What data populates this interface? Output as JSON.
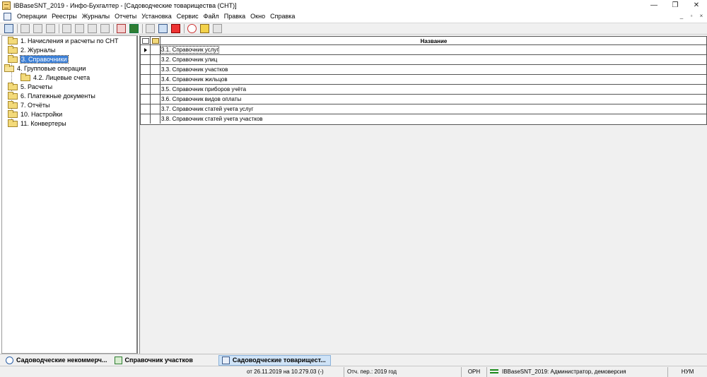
{
  "window": {
    "title": "IBBaseSNT_2019 - Инфо-Бухгалтер - [Садоводческие товарищества (СНТ)]",
    "controls": [
      "—",
      "❐",
      "✕"
    ]
  },
  "menu": {
    "items": [
      "Операции",
      "Реестры",
      "Журналы",
      "Отчеты",
      "Установка",
      "Сервис",
      "Файл",
      "Правка",
      "Окно",
      "Справка"
    ],
    "mdi_controls": [
      "_",
      "▫",
      "×"
    ]
  },
  "tree": {
    "items": [
      {
        "label": "1. Начисления и расчеты по СНТ",
        "level": 0,
        "open": false,
        "selected": false
      },
      {
        "label": "2. Журналы",
        "level": 0,
        "open": false,
        "selected": false
      },
      {
        "label": "3. Справочники",
        "level": 0,
        "open": false,
        "selected": true
      },
      {
        "label": "4. Групповые операции",
        "level": 0,
        "open": true,
        "selected": false
      },
      {
        "label": "4.2. Лицевые счета",
        "level": 1,
        "open": false,
        "selected": false
      },
      {
        "label": "5. Расчеты",
        "level": 0,
        "open": false,
        "selected": false
      },
      {
        "label": "6. Платежные документы",
        "level": 0,
        "open": false,
        "selected": false
      },
      {
        "label": "7. Отчёты",
        "level": 0,
        "open": false,
        "selected": false
      },
      {
        "label": "10. Настройки",
        "level": 0,
        "open": false,
        "selected": false
      },
      {
        "label": "11. Конвертеры",
        "level": 0,
        "open": false,
        "selected": false
      }
    ]
  },
  "grid": {
    "column_header": "Название",
    "rows": [
      "3.1. Справочник услуг",
      "3.2. Справочник улиц",
      "3.3. Справочник участков",
      "3.4. Справочник жильцов",
      "3.5. Справочник приборов учёта",
      "3.6. Справочник видов оплаты",
      "3.7. Справочник статей учета услуг",
      "3.8. Справочник статей учета участков"
    ],
    "current_row": 0
  },
  "window_tabs": [
    {
      "label": "Садоводческие некоммерч...",
      "icon": "circle",
      "active": false
    },
    {
      "label": "Справочник участков",
      "icon": "tree",
      "active": false
    },
    {
      "label": "Садоводческие товарищест...",
      "icon": "doc",
      "active": true
    }
  ],
  "status": {
    "period": "от 26.11.2019 на 10.279.03 (-)",
    "report_period": "Отч. пер.: 2019 год",
    "mode": "ОРН",
    "connection": "IBBaseSNT_2019: Администратор, демоверсия",
    "numlock": "НУМ"
  }
}
